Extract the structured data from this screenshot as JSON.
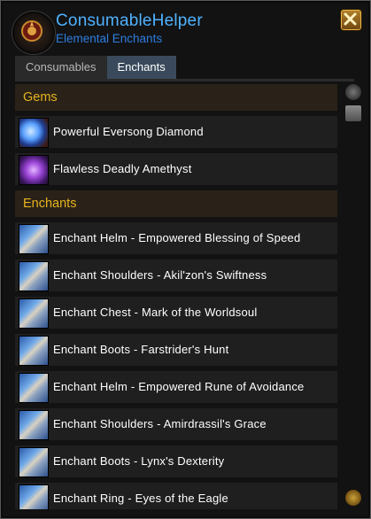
{
  "window": {
    "title": "ConsumableHelper",
    "subtitle": "Elemental Enchants"
  },
  "tabs": [
    {
      "label": "Consumables",
      "active": false
    },
    {
      "label": "Enchants",
      "active": true
    }
  ],
  "sections": [
    {
      "header": "Gems",
      "items": [
        {
          "label": "Powerful Eversong Diamond",
          "icon": "diamond-gem-icon"
        },
        {
          "label": "Flawless Deadly Amethyst",
          "icon": "amethyst-gem-icon"
        }
      ]
    },
    {
      "header": "Enchants",
      "items": [
        {
          "label": "Enchant Helm - Empowered Blessing of Speed",
          "icon": "enchant-scroll-icon"
        },
        {
          "label": "Enchant Shoulders - Akil'zon's Swiftness",
          "icon": "enchant-scroll-icon"
        },
        {
          "label": "Enchant Chest - Mark of the Worldsoul",
          "icon": "enchant-scroll-icon"
        },
        {
          "label": "Enchant Boots - Farstrider's Hunt",
          "icon": "enchant-scroll-icon"
        },
        {
          "label": "Enchant Helm - Empowered Rune of Avoidance",
          "icon": "enchant-scroll-icon"
        },
        {
          "label": "Enchant Shoulders - Amirdrassil's Grace",
          "icon": "enchant-scroll-icon"
        },
        {
          "label": "Enchant Boots - Lynx's Dexterity",
          "icon": "enchant-scroll-icon"
        },
        {
          "label": "Enchant Ring - Eyes of the Eagle",
          "icon": "enchant-scroll-icon"
        }
      ]
    }
  ],
  "colors": {
    "title": "#4fb2ff",
    "subtitle": "#2f7de0",
    "section_header": "#e7b31d",
    "active_tab": "#3a4a5c"
  }
}
